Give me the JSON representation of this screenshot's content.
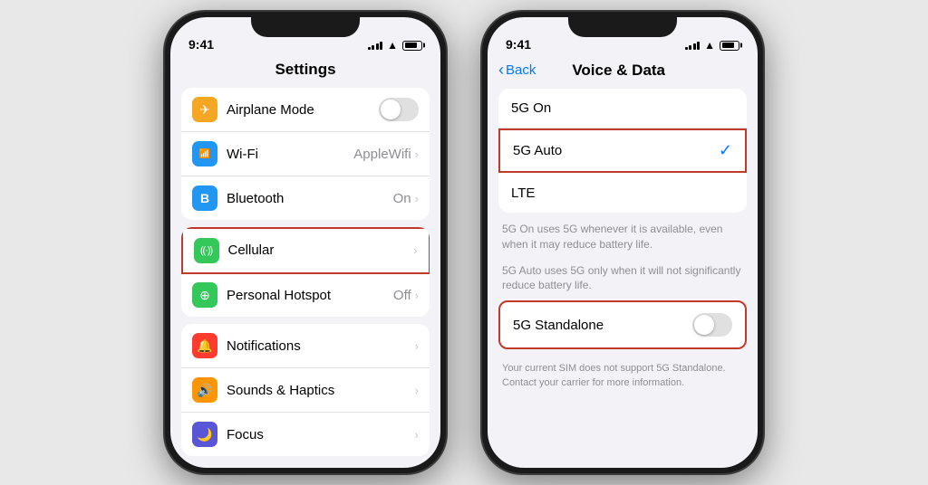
{
  "left_phone": {
    "status": {
      "time": "9:41",
      "signal": [
        3,
        5,
        7,
        9,
        11
      ],
      "battery_level": "80%"
    },
    "title": "Settings",
    "group1": {
      "items": [
        {
          "icon_color": "#f5a623",
          "icon": "✈",
          "label": "Airplane Mode",
          "value": "",
          "type": "toggle"
        },
        {
          "icon_color": "#2196f3",
          "icon": "📶",
          "label": "Wi-Fi",
          "value": "AppleWifi",
          "type": "chevron"
        },
        {
          "icon_color": "#2196f3",
          "icon": "B",
          "label": "Bluetooth",
          "value": "On",
          "type": "chevron"
        }
      ]
    },
    "group2": {
      "items": [
        {
          "icon_color": "#34c759",
          "icon": "((·))",
          "label": "Cellular",
          "value": "",
          "type": "chevron",
          "highlighted": true
        },
        {
          "icon_color": "#34c759",
          "icon": "⊕",
          "label": "Personal Hotspot",
          "value": "Off",
          "type": "chevron"
        }
      ]
    },
    "group3": {
      "items": [
        {
          "icon_color": "#ff3b30",
          "icon": "🔔",
          "label": "Notifications",
          "value": "",
          "type": "chevron"
        },
        {
          "icon_color": "#ff9500",
          "icon": "🔊",
          "label": "Sounds & Haptics",
          "value": "",
          "type": "chevron"
        },
        {
          "icon_color": "#5856d6",
          "icon": "🌙",
          "label": "Focus",
          "value": "",
          "type": "chevron"
        }
      ]
    }
  },
  "right_phone": {
    "status": {
      "time": "9:41"
    },
    "nav": {
      "back_label": "Back",
      "title": "Voice & Data"
    },
    "options": [
      {
        "label": "5G On",
        "selected": false,
        "highlighted": false
      },
      {
        "label": "5G Auto",
        "selected": true,
        "highlighted": true
      },
      {
        "label": "LTE",
        "selected": false,
        "highlighted": false
      }
    ],
    "desc1": "5G On uses 5G whenever it is available, even when it may reduce battery life.",
    "desc2": "5G Auto uses 5G only when it will not significantly reduce battery life.",
    "standalone": {
      "label": "5G Standalone",
      "enabled": false,
      "highlighted": true
    },
    "standalone_desc": "Your current SIM does not support 5G Standalone. Contact your carrier for more information."
  },
  "icons": {
    "airplane": "✈",
    "wifi": "((·))",
    "bluetooth": "B",
    "cellular": "((·))",
    "hotspot": "⊕",
    "notifications": "🔔",
    "sounds": "🔊",
    "focus": "🌙",
    "check": "✓",
    "chevron": "›",
    "back_chevron": "‹"
  }
}
